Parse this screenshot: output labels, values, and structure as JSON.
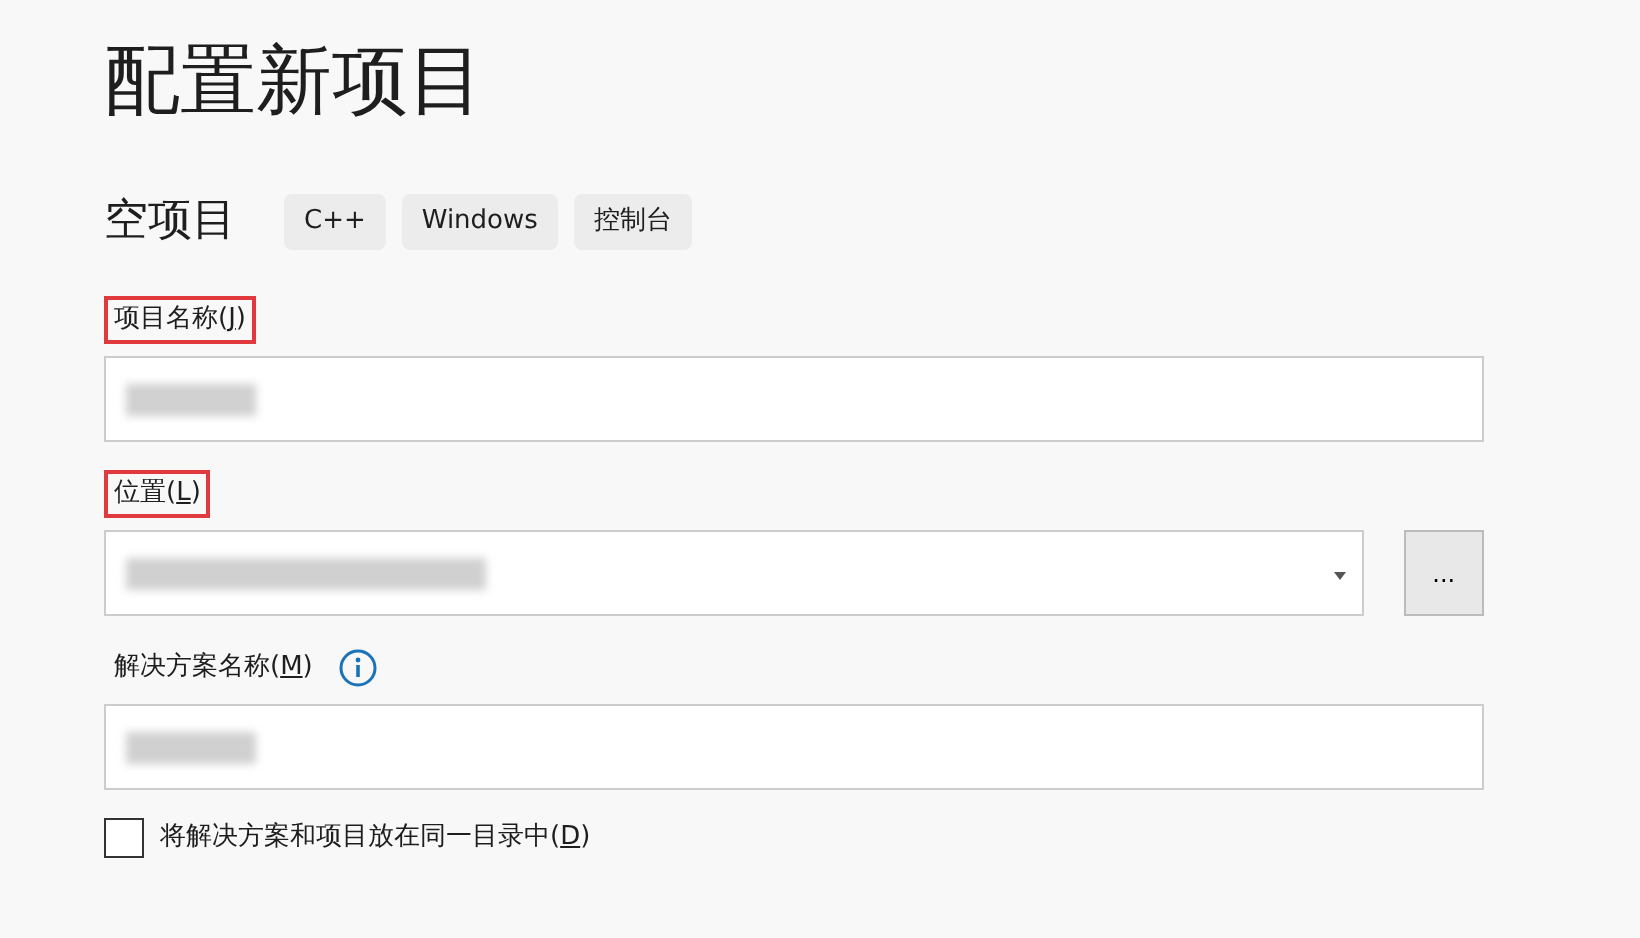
{
  "title": "配置新项目",
  "template": {
    "name": "空项目",
    "tags": [
      "C++",
      "Windows",
      "控制台"
    ]
  },
  "fields": [
    {
      "kind": "text",
      "label_start": "项目名称(",
      "access_key": "J",
      "label_end": ")",
      "highlighted": true,
      "redacted": true,
      "info": false
    },
    {
      "kind": "dropdown",
      "label_start": "位置(",
      "access_key": "L",
      "label_end": ")",
      "highlighted": true,
      "redacted": true,
      "info": false,
      "browse_label": "..."
    },
    {
      "kind": "text",
      "label_start": "解决方案名称(",
      "access_key": "M",
      "label_end": ")",
      "highlighted": false,
      "redacted": true,
      "info": true
    }
  ],
  "same_dir": {
    "label_start": "将解决方案和项目放在同一目录中(",
    "access_key": "D",
    "label_end": ")",
    "checked": false
  }
}
